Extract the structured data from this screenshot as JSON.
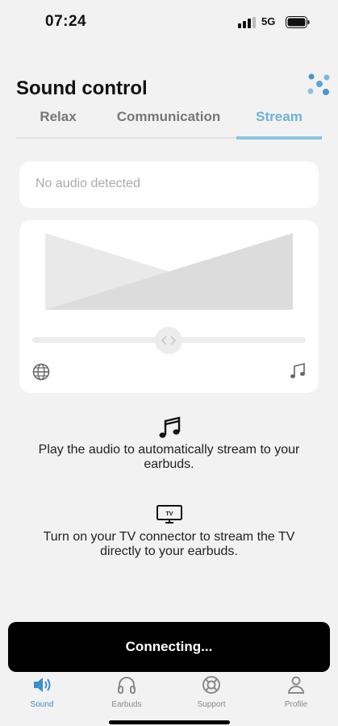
{
  "status_bar": {
    "time": "07:24",
    "network": "5G"
  },
  "header": {
    "title": "Sound control"
  },
  "tabs": [
    {
      "label": "Relax"
    },
    {
      "label": "Communication"
    },
    {
      "label": "Stream",
      "active": true
    }
  ],
  "audio_card": {
    "text": "No audio detected"
  },
  "mix": {
    "left_icon": "globe-icon",
    "right_icon": "music-note-icon",
    "slider_position": 0.5
  },
  "info": {
    "stream_text": "Play the audio to automatically stream to your earbuds.",
    "tv_text": "Turn on your TV connector to stream the TV directly to your earbuds.",
    "tv_badge": "TV"
  },
  "banner": {
    "text": "Connecting..."
  },
  "nav": [
    {
      "label": "Sound",
      "icon": "speaker-icon",
      "active": true
    },
    {
      "label": "Earbuds",
      "icon": "headphones-icon"
    },
    {
      "label": "Support",
      "icon": "lifebuoy-icon"
    },
    {
      "label": "Profile",
      "icon": "person-icon"
    }
  ],
  "colors": {
    "accent": "#6cb2db",
    "nav_active": "#3a8fcf",
    "background": "#f2f2f2"
  }
}
